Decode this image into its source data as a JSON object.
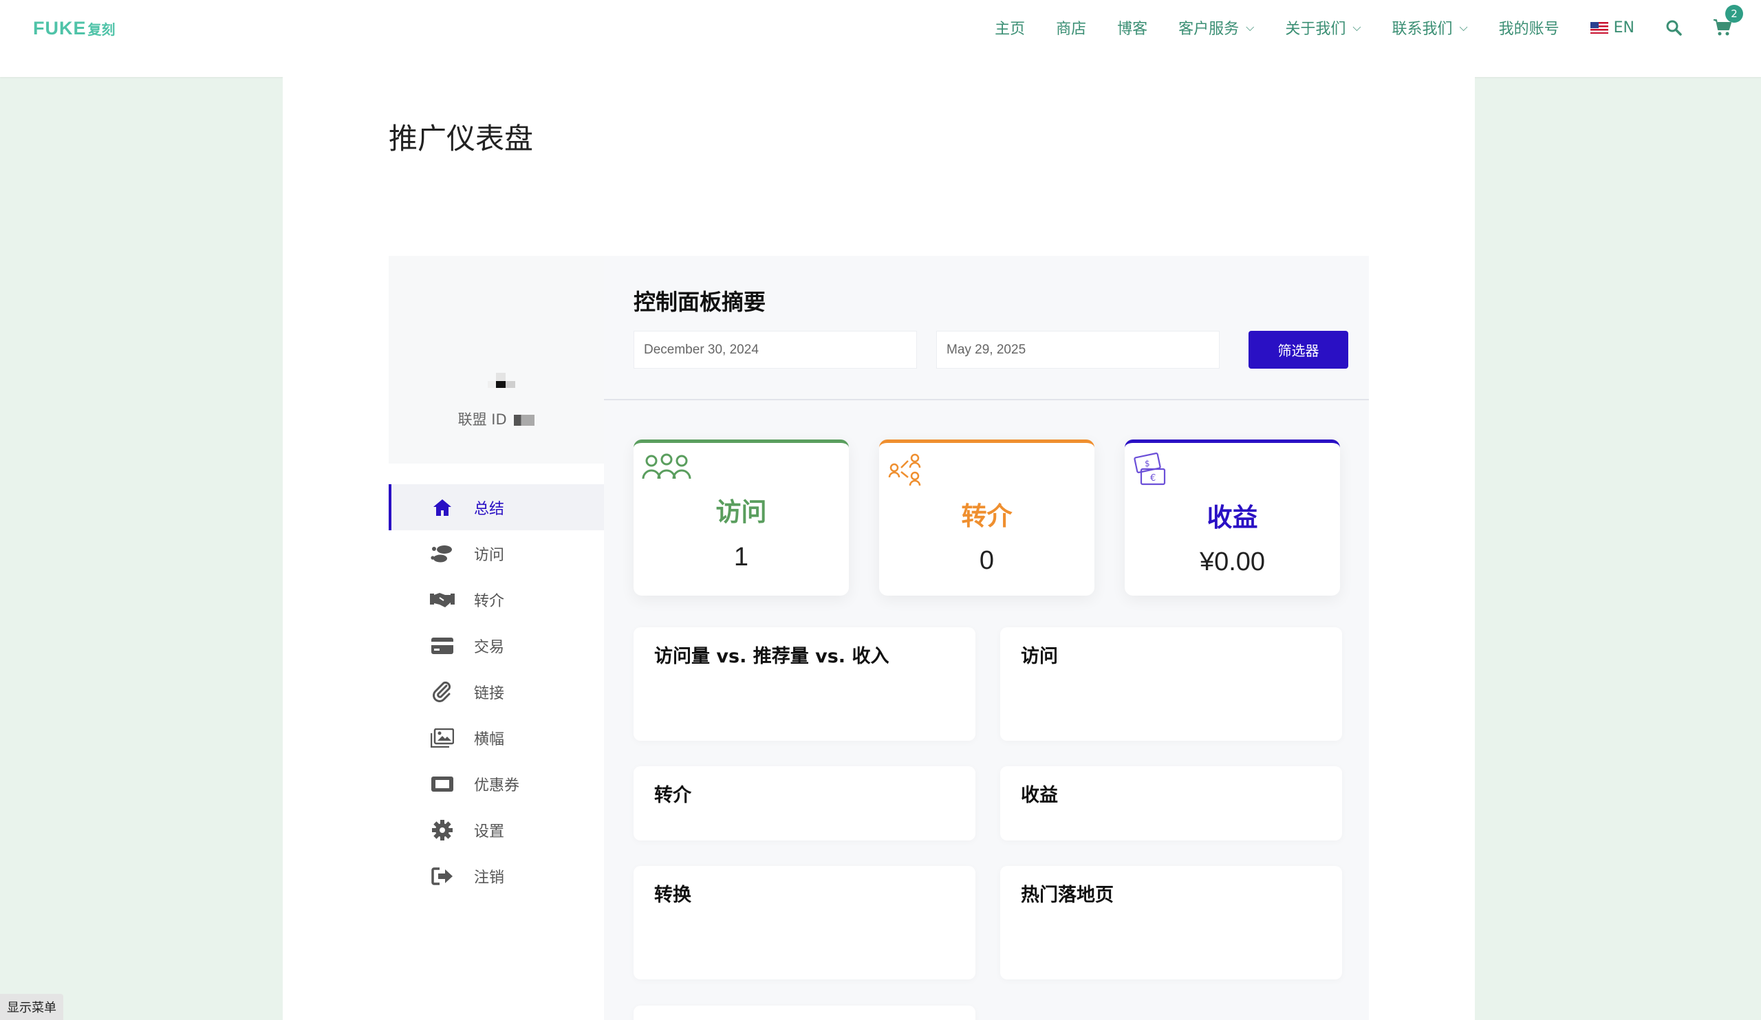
{
  "header": {
    "logo_text": "FUKE",
    "logo_cn": "复刻",
    "nav": [
      {
        "label": "主页",
        "dropdown": false
      },
      {
        "label": "商店",
        "dropdown": false
      },
      {
        "label": "博客",
        "dropdown": false
      },
      {
        "label": "客户服务",
        "dropdown": true
      },
      {
        "label": "关于我们",
        "dropdown": true
      },
      {
        "label": "联系我们",
        "dropdown": true
      },
      {
        "label": "我的账号",
        "dropdown": false
      }
    ],
    "language": "EN",
    "cart_count": "2",
    "accent_color": "#3b8f74"
  },
  "page": {
    "title": "推广仪表盘"
  },
  "sidebar": {
    "affiliate_id_label": "联盟 ID",
    "items": [
      {
        "label": "总结",
        "icon": "home-icon",
        "active": true
      },
      {
        "label": "访问",
        "icon": "footsteps-icon",
        "active": false
      },
      {
        "label": "转介",
        "icon": "handshake-icon",
        "active": false
      },
      {
        "label": "交易",
        "icon": "credit-card-icon",
        "active": false
      },
      {
        "label": "链接",
        "icon": "paperclip-icon",
        "active": false
      },
      {
        "label": "横幅",
        "icon": "images-icon",
        "active": false
      },
      {
        "label": "优惠券",
        "icon": "ticket-icon",
        "active": false
      },
      {
        "label": "设置",
        "icon": "gear-icon",
        "active": false
      },
      {
        "label": "注销",
        "icon": "sign-out-icon",
        "active": false
      }
    ],
    "active_color": "#2a10c4"
  },
  "summary": {
    "title": "控制面板摘要",
    "date_from": "December 30, 2024",
    "date_to": "May 29, 2025",
    "filter_label": "筛选器"
  },
  "stats": [
    {
      "label": "访问",
      "value": "1",
      "color": "#5a9e5e",
      "icon": "visitors-icon"
    },
    {
      "label": "转介",
      "value": "0",
      "color": "#ef8f2f",
      "icon": "referral-icon"
    },
    {
      "label": "收益",
      "value": "¥0.00",
      "color": "#2a10c4",
      "icon": "money-icon"
    }
  ],
  "panels": [
    {
      "title": "访问量 vs. 推荐量 vs. 收入"
    },
    {
      "title": "访问"
    },
    {
      "title": "转介"
    },
    {
      "title": "收益"
    },
    {
      "title": "转换"
    },
    {
      "title": "热门落地页"
    }
  ],
  "footer": {
    "show_menu": "显示菜单"
  }
}
